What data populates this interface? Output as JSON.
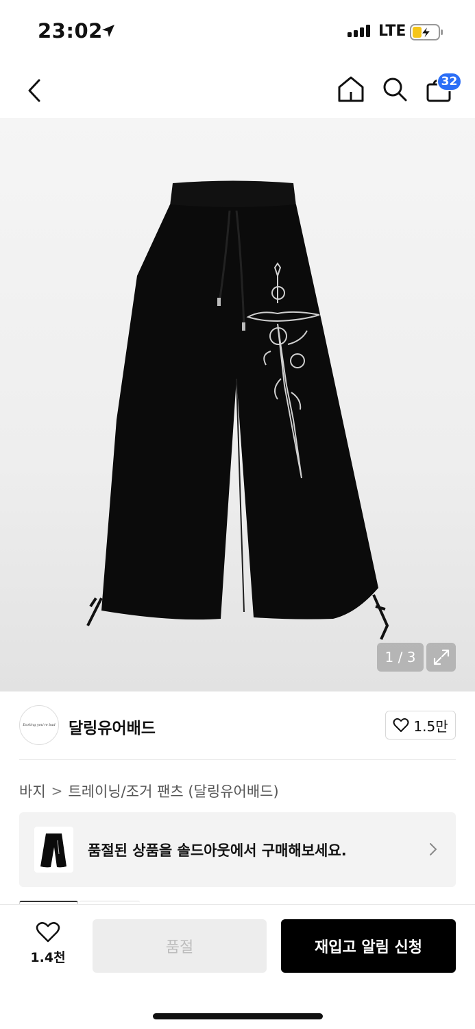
{
  "status_bar": {
    "time": "23:02",
    "network": "LTE"
  },
  "nav": {
    "cart_count": "32",
    "icons": [
      "back-chevron-icon",
      "home-icon",
      "search-icon",
      "cart-icon"
    ]
  },
  "gallery": {
    "page_indicator": "1 / 3",
    "current_page": 1,
    "total_pages": 3
  },
  "brand": {
    "logo_text": "Darling you're bad",
    "name": "달링유어배드",
    "like_count": "1.5만"
  },
  "breadcrumb": {
    "category": "바지",
    "separator": ">",
    "subcategory": "트레이닝/조거 팬츠 (달링유어배드)"
  },
  "soldout_banner": {
    "text": "품절된 상품을 솔드아웃에서 구매해보세요."
  },
  "bottom_bar": {
    "like_count": "1.4천",
    "soldout_label": "품절",
    "restock_label": "재입고 알림 신청"
  },
  "colors": {
    "badge": "#2b6ef6",
    "primary_button": "#000000",
    "disabled_button": "#ededed"
  }
}
